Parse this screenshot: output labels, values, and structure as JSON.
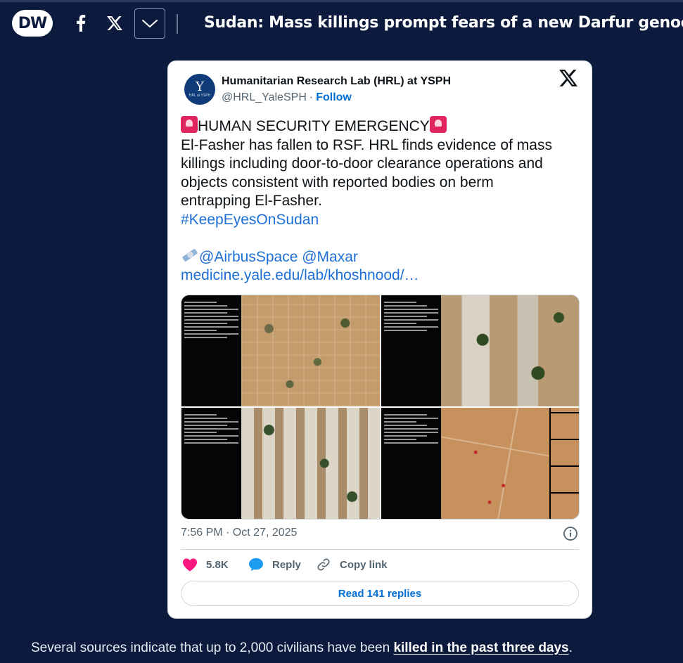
{
  "header": {
    "logo_text": "DW",
    "headline": "Sudan: Mass killings prompt fears of a new Darfur genocide"
  },
  "tweet": {
    "avatar_letter": "Y",
    "avatar_caption": "HRL at YSPH",
    "account_name": "Humanitarian Research Lab (HRL) at YSPH",
    "handle": "@HRL_YaleSPH",
    "separator": "·",
    "follow_label": "Follow",
    "text_heading": "HUMAN SECURITY EMERGENCY",
    "text_line1": "El-Fasher has fallen to RSF. HRL finds evidence of mass",
    "text_line2": "killings including door-to-door clearance operations and",
    "text_line3": "objects consistent with reported bodies on berm",
    "text_line4": "entrapping El-Fasher.",
    "hashtag": "#KeepEyesOnSudan",
    "mentions": "@AirbusSpace @Maxar",
    "link": "medicine.yale.edu/lab/khoshnood/…",
    "timestamp": "7:56 PM · Oct 27, 2025",
    "likes": "5.8K",
    "reply_label": "Reply",
    "copy_link_label": "Copy link",
    "read_replies_label": "Read 141 replies"
  },
  "article": {
    "text_before": "Several sources indicate that up to 2,000 civilians have been ",
    "link_text": "killed in the past three days",
    "text_after": "."
  },
  "colors": {
    "page_background": "#0b1a3d",
    "link_blue": "#006fd6",
    "like_pink": "#f91880",
    "reply_blue": "#1d9bf0"
  }
}
